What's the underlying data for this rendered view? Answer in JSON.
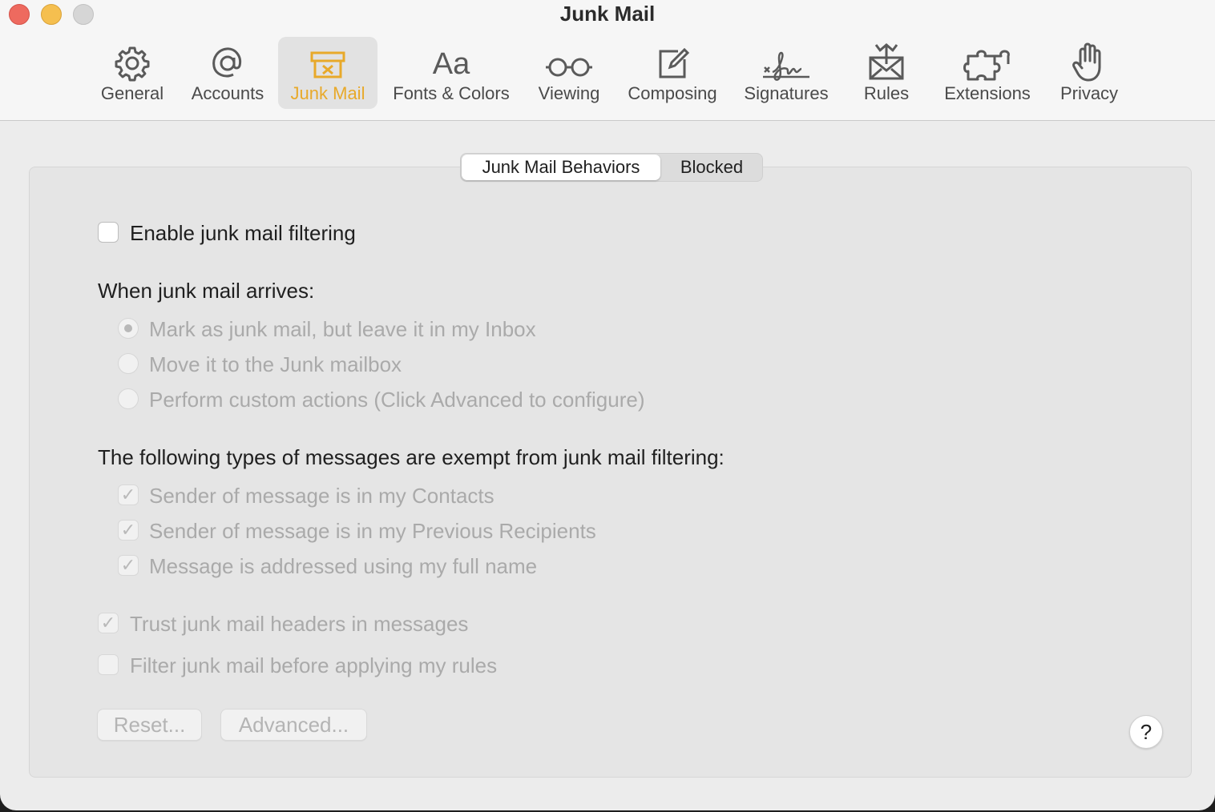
{
  "window": {
    "title": "Junk Mail"
  },
  "toolbar": {
    "items": [
      {
        "label": "General",
        "icon": "gear-icon"
      },
      {
        "label": "Accounts",
        "icon": "at-sign-icon"
      },
      {
        "label": "Junk Mail",
        "icon": "junk-tray-icon",
        "active": true
      },
      {
        "label": "Fonts & Colors",
        "icon": "fonts-icon",
        "glyph": "Aa"
      },
      {
        "label": "Viewing",
        "icon": "glasses-icon"
      },
      {
        "label": "Composing",
        "icon": "compose-icon"
      },
      {
        "label": "Signatures",
        "icon": "signature-icon"
      },
      {
        "label": "Rules",
        "icon": "rules-envelope-icon"
      },
      {
        "label": "Extensions",
        "icon": "puzzle-icon"
      },
      {
        "label": "Privacy",
        "icon": "hand-icon"
      }
    ]
  },
  "segmented": {
    "behaviors": "Junk Mail Behaviors",
    "blocked": "Blocked"
  },
  "content": {
    "enable_filtering": {
      "label": "Enable junk mail filtering",
      "checked": false
    },
    "arrival_heading": "When junk mail arrives:",
    "arrival_options": [
      {
        "label": "Mark as junk mail, but leave it in my Inbox",
        "selected": true
      },
      {
        "label": "Move it to the Junk mailbox",
        "selected": false
      },
      {
        "label": "Perform custom actions (Click Advanced to configure)",
        "selected": false
      }
    ],
    "exempt_heading": "The following types of messages are exempt from junk mail filtering:",
    "exempt_options": [
      {
        "label": "Sender of message is in my Contacts",
        "checked": true
      },
      {
        "label": "Sender of message is in my Previous Recipients",
        "checked": true
      },
      {
        "label": "Message is addressed using my full name",
        "checked": true
      }
    ],
    "trust_headers": {
      "label": "Trust junk mail headers in messages",
      "checked": true
    },
    "filter_before_rules": {
      "label": "Filter junk mail before applying my rules",
      "checked": false
    },
    "reset_button": "Reset...",
    "advanced_button": "Advanced...",
    "help_button": "?"
  },
  "colors": {
    "accent": "#e8a92a",
    "disabled_text": "#aaaaaa",
    "text": "#1f1f1f"
  }
}
